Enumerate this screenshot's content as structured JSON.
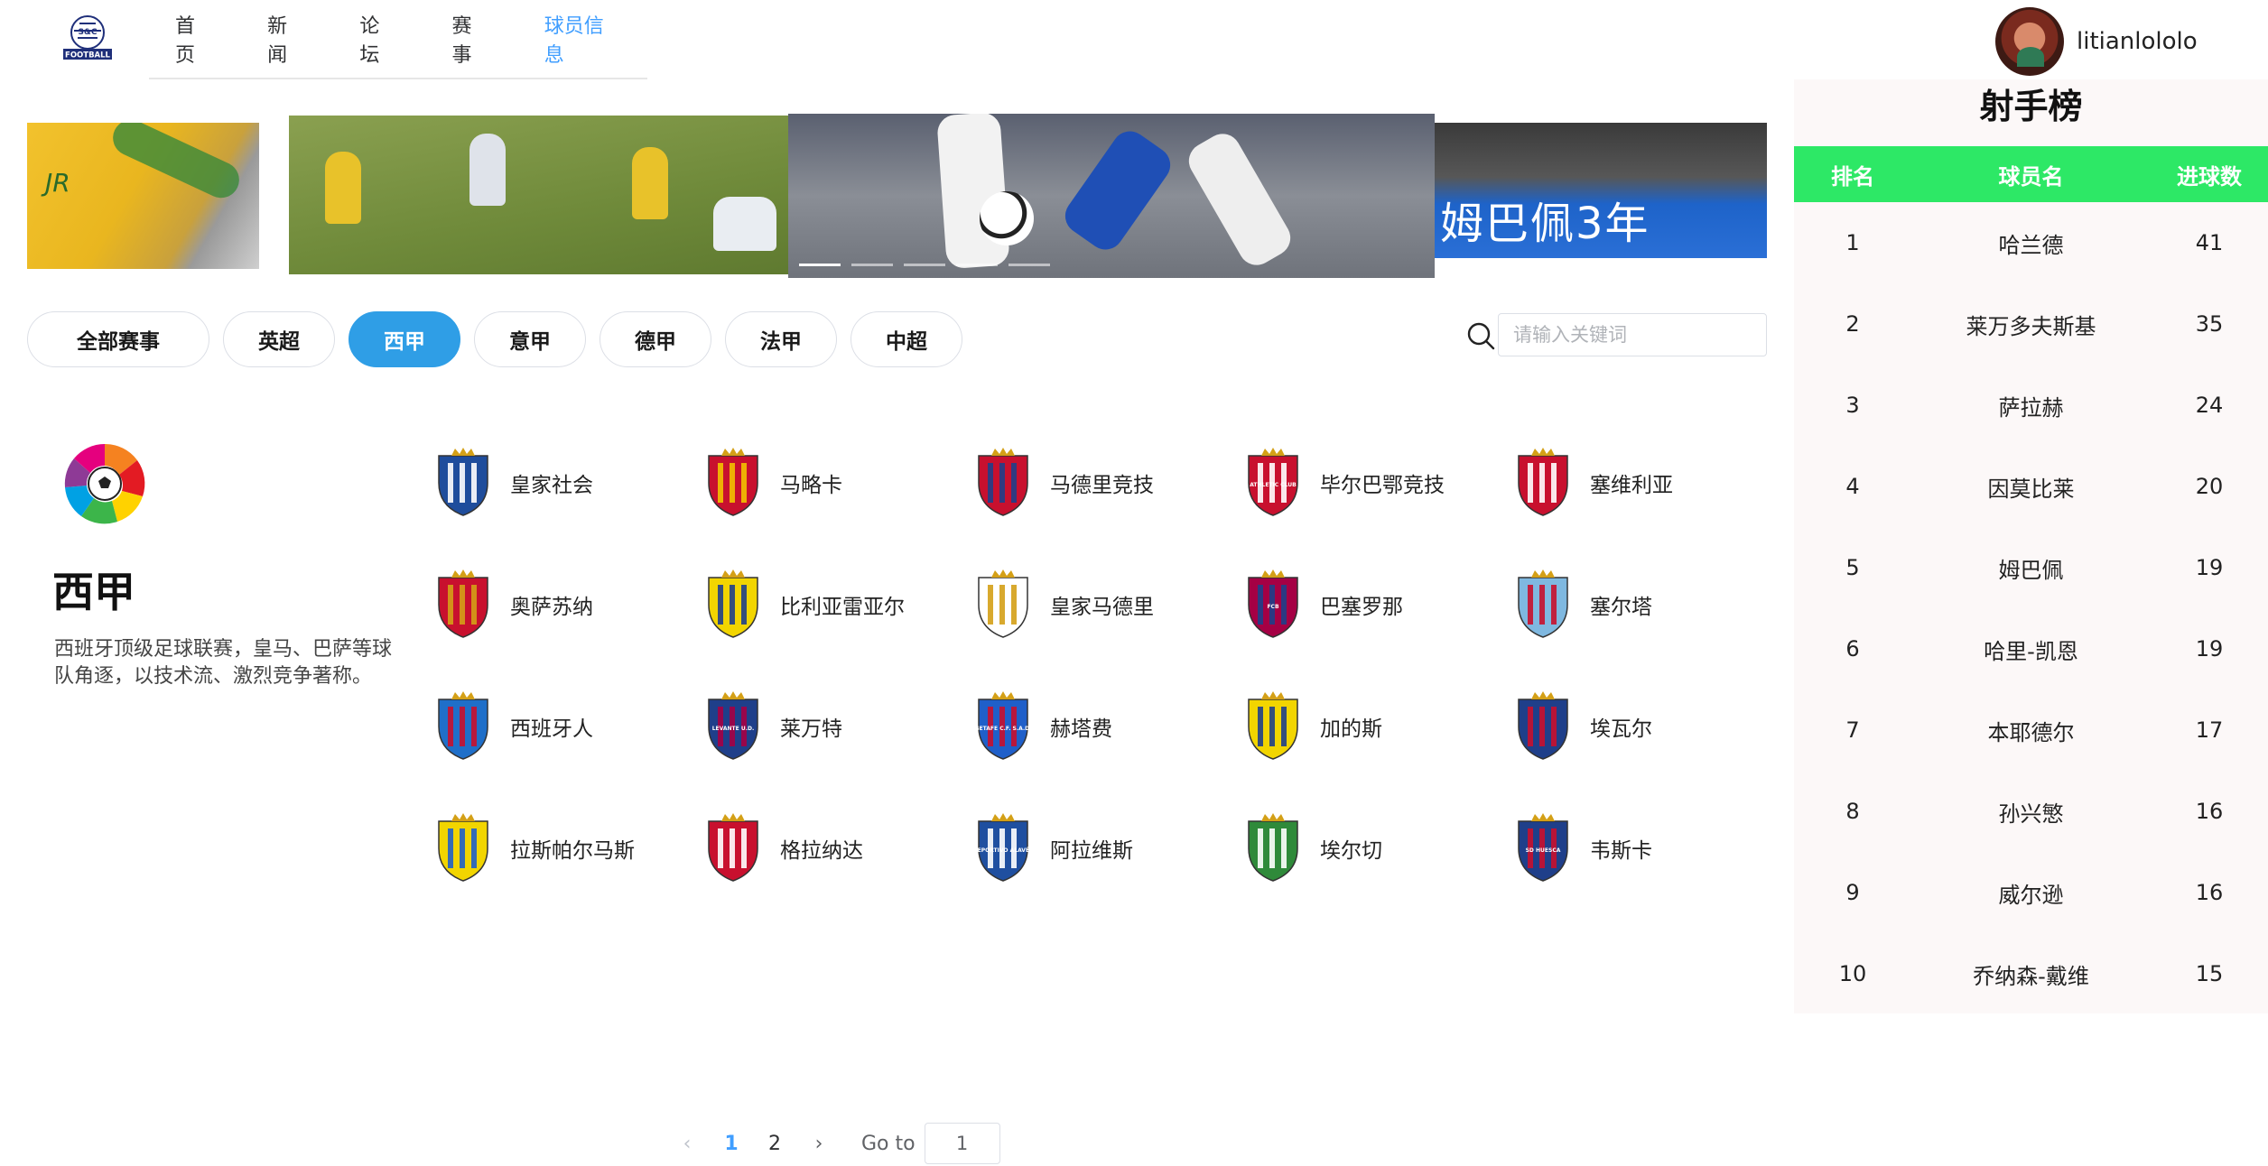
{
  "nav": {
    "logo_text": "FOOTBALL",
    "items": [
      {
        "label": "首页"
      },
      {
        "label": "新闻"
      },
      {
        "label": "论坛"
      },
      {
        "label": "赛事"
      },
      {
        "label": "球员信息"
      }
    ],
    "active_index": 4
  },
  "user": {
    "name": "litianlololo"
  },
  "carousel": {
    "slide1_text": "JR",
    "slide4_caption": "姆巴佩3年",
    "dots": 5,
    "active_dot": 0
  },
  "filters": {
    "chips": [
      {
        "label": "全部赛事"
      },
      {
        "label": "英超"
      },
      {
        "label": "西甲"
      },
      {
        "label": "意甲"
      },
      {
        "label": "德甲"
      },
      {
        "label": "法甲"
      },
      {
        "label": "中超"
      }
    ],
    "active_index": 2
  },
  "search": {
    "placeholder": "请输入关键词",
    "value": ""
  },
  "league": {
    "name": "西甲",
    "description": "西班牙顶级足球联赛，皇马、巴萨等球队角逐，以技术流、激烈竞争著称。"
  },
  "teams": [
    {
      "name": "皇家社会",
      "colors": [
        "#1f4d9c",
        "#ffffff"
      ],
      "crest_text": ""
    },
    {
      "name": "马略卡",
      "colors": [
        "#c8102e",
        "#f2c200"
      ],
      "crest_text": ""
    },
    {
      "name": "马德里竞技",
      "colors": [
        "#c8102e",
        "#1f3f8a"
      ],
      "crest_text": ""
    },
    {
      "name": "毕尔巴鄂竞技",
      "colors": [
        "#c8102e",
        "#ffffff"
      ],
      "crest_text": "ATHLETIC CLUB"
    },
    {
      "name": "塞维利亚",
      "colors": [
        "#c8102e",
        "#ffffff"
      ],
      "crest_text": ""
    },
    {
      "name": "奥萨苏纳",
      "colors": [
        "#c8102e",
        "#d4a017"
      ],
      "crest_text": ""
    },
    {
      "name": "比利亚雷亚尔",
      "colors": [
        "#f2d500",
        "#1f3f8a"
      ],
      "crest_text": ""
    },
    {
      "name": "皇家马德里",
      "colors": [
        "#ffffff",
        "#d4a017"
      ],
      "crest_text": ""
    },
    {
      "name": "巴塞罗那",
      "colors": [
        "#a50044",
        "#1f3f8a"
      ],
      "crest_text": "FCB"
    },
    {
      "name": "塞尔塔",
      "colors": [
        "#7fb8e0",
        "#c8102e"
      ],
      "crest_text": ""
    },
    {
      "name": "西班牙人",
      "colors": [
        "#1f6fc9",
        "#c8102e"
      ],
      "crest_text": ""
    },
    {
      "name": "莱万特",
      "colors": [
        "#1f3f8a",
        "#a50044"
      ],
      "crest_text": "LEVANTE U.D."
    },
    {
      "name": "赫塔费",
      "colors": [
        "#1f5fc9",
        "#c8102e"
      ],
      "crest_text": "GETAFE C.F. S.A.D."
    },
    {
      "name": "加的斯",
      "colors": [
        "#f2d500",
        "#1f3f8a"
      ],
      "crest_text": ""
    },
    {
      "name": "埃瓦尔",
      "colors": [
        "#1f3f8a",
        "#c8102e"
      ],
      "crest_text": ""
    },
    {
      "name": "拉斯帕尔马斯",
      "colors": [
        "#f2d500",
        "#1f5fc9"
      ],
      "crest_text": ""
    },
    {
      "name": "格拉纳达",
      "colors": [
        "#c8102e",
        "#ffffff"
      ],
      "crest_text": ""
    },
    {
      "name": "阿拉维斯",
      "colors": [
        "#1f4fa0",
        "#ffffff"
      ],
      "crest_text": "DEPORTIVO ALAVÉS"
    },
    {
      "name": "埃尔切",
      "colors": [
        "#2f8a3a",
        "#ffffff"
      ],
      "crest_text": ""
    },
    {
      "name": "韦斯卡",
      "colors": [
        "#1f3f8a",
        "#c8102e"
      ],
      "crest_text": "SD HUESCA"
    }
  ],
  "scorers": {
    "title": "射手榜",
    "headers": {
      "rank": "排名",
      "name": "球员名",
      "goals": "进球数"
    },
    "rows": [
      {
        "rank": "1",
        "name": "哈兰德",
        "goals": "41"
      },
      {
        "rank": "2",
        "name": "莱万多夫斯基",
        "goals": "35"
      },
      {
        "rank": "3",
        "name": "萨拉赫",
        "goals": "24"
      },
      {
        "rank": "4",
        "name": "因莫比莱",
        "goals": "20"
      },
      {
        "rank": "5",
        "name": "姆巴佩",
        "goals": "19"
      },
      {
        "rank": "6",
        "name": "哈里-凯恩",
        "goals": "19"
      },
      {
        "rank": "7",
        "name": "本耶德尔",
        "goals": "17"
      },
      {
        "rank": "8",
        "name": "孙兴慜",
        "goals": "16"
      },
      {
        "rank": "9",
        "name": "威尔逊",
        "goals": "16"
      },
      {
        "rank": "10",
        "name": "乔纳森-戴维",
        "goals": "15"
      }
    ]
  },
  "pagination": {
    "prev": "‹",
    "next": "›",
    "pages": [
      "1",
      "2"
    ],
    "current": "1",
    "goto_label": "Go to",
    "goto_value": "1"
  },
  "colors": {
    "accent": "#409eff",
    "chip_active": "#2f9ee6",
    "scorer_header": "#2de866",
    "scorer_bg": "#fcf8f8"
  }
}
